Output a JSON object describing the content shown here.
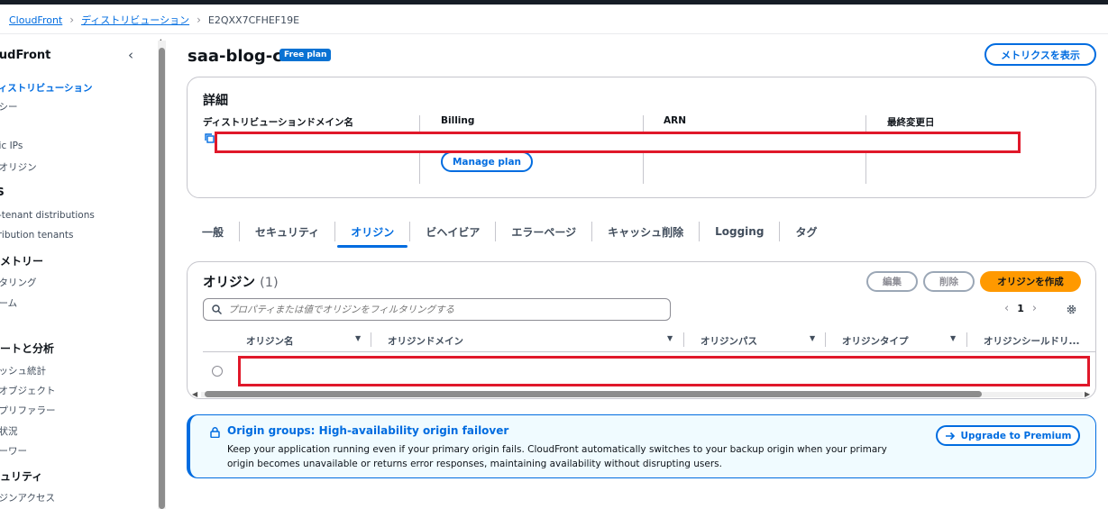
{
  "breadcrumb": {
    "items": [
      "CloudFront",
      "ディストリビューション"
    ],
    "current": "E2QXX7CFHEF19E"
  },
  "sidebar": {
    "title": "oudFront",
    "items": [
      {
        "label": "ディストリビューション",
        "active": true
      },
      {
        "label": "リシー"
      },
      {
        "label": "数"
      },
      {
        "label": "atic IPs"
      },
      {
        "label": "C オリジン"
      }
    ],
    "sections": [
      {
        "title": "aS",
        "items": [
          "lti-tenant distributions",
          "stribution tenants"
        ]
      },
      {
        "title": "レメトリー",
        "items": [
          "ニタリング",
          "ラーム",
          "グ"
        ]
      },
      {
        "title": "ポートと分析",
        "items": [
          "ャッシュ統計",
          "気オブジェクト",
          "ップリファラー",
          "用状況",
          "ューワー"
        ]
      },
      {
        "title": "キュリティ",
        "items": [
          "リジンアクセス"
        ]
      }
    ]
  },
  "page": {
    "title": "saa-blog-cf",
    "badge": "Free plan",
    "metrics_button": "メトリクスを表示"
  },
  "details": {
    "title": "詳細",
    "columns": [
      "ディストリビューションドメイン名",
      "Billing",
      "ARN",
      "最終変更日"
    ],
    "manage_plan": "Manage plan"
  },
  "tabs": [
    {
      "label": "一般"
    },
    {
      "label": "セキュリティ"
    },
    {
      "label": "オリジン",
      "active": true
    },
    {
      "label": "ビヘイビア"
    },
    {
      "label": "エラーページ"
    },
    {
      "label": "キャッシュ削除"
    },
    {
      "label": "Logging"
    },
    {
      "label": "タグ"
    }
  ],
  "origins": {
    "title": "オリジン",
    "count": "(1)",
    "edit": "編集",
    "delete": "削除",
    "create": "オリジンを作成",
    "filter_placeholder": "プロパティまたは値でオリジンをフィルタリングする",
    "page": "1",
    "columns": [
      "オリジン名",
      "オリジンドメイン",
      "オリジンパス",
      "オリジンタイプ",
      "オリジンシールドリ..."
    ]
  },
  "info": {
    "title": "Origin groups: High-availability origin failover",
    "text": "Keep your application running even if your primary origin fails. CloudFront automatically switches to your backup origin when your primary origin becomes unavailable or returns error responses, maintaining availability without disrupting users.",
    "upgrade": "Upgrade to Premium"
  },
  "colors": {
    "accent": "#006ce0",
    "create": "#ff9900",
    "redaction": "#e0182a"
  }
}
